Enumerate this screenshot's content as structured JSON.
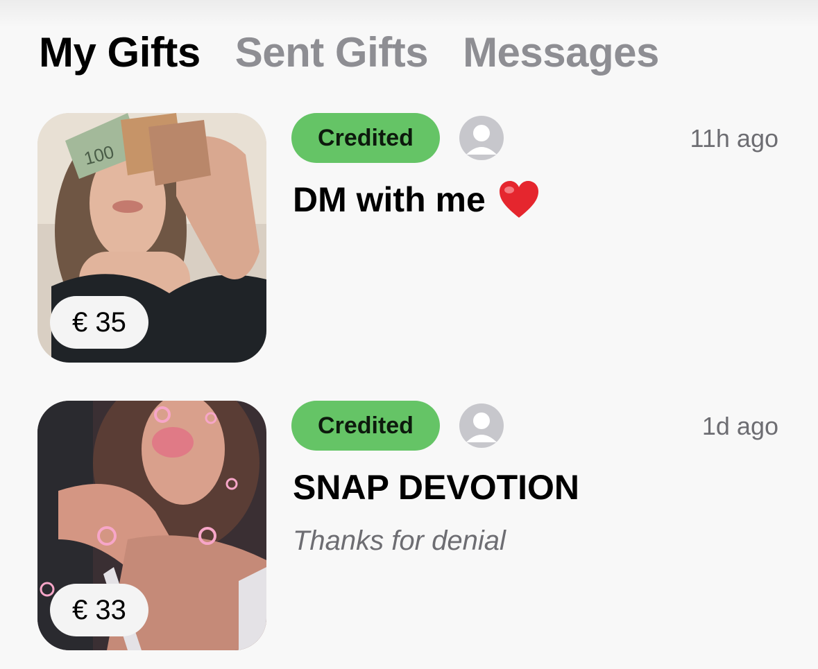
{
  "tabs": [
    {
      "label": "My Gifts",
      "active": true
    },
    {
      "label": "Sent Gifts",
      "active": false
    },
    {
      "label": "Messages",
      "active": false
    }
  ],
  "gifts": [
    {
      "price": "€ 35",
      "status": "Credited",
      "time": "11h ago",
      "title": "DM with me",
      "emoji": "heart-emoji",
      "subtitle": ""
    },
    {
      "price": "€ 33",
      "status": "Credited",
      "time": "1d ago",
      "title": "SNAP DEVOTION",
      "emoji": "",
      "subtitle": "Thanks for denial"
    }
  ],
  "colors": {
    "badge": "#65c466",
    "tab_active": "#000000",
    "tab_inactive": "#8e8e93"
  }
}
